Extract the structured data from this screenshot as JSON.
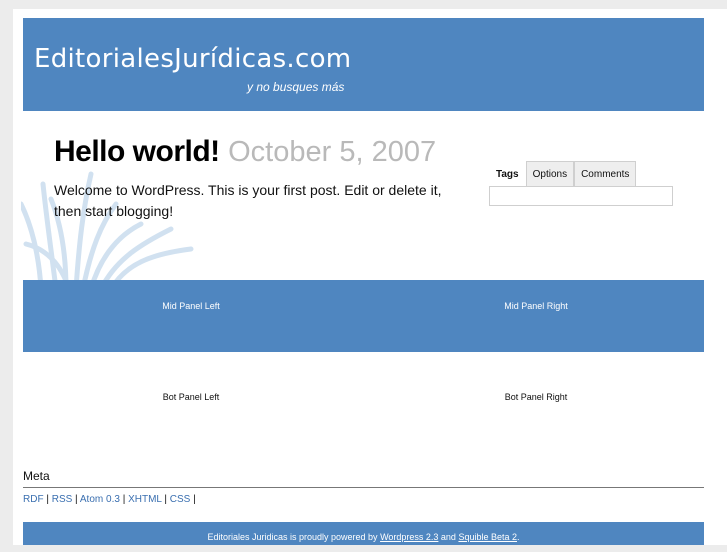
{
  "header": {
    "site_title": "EditorialesJurídicas.com",
    "tagline": "y no busques más",
    "background_color": "#4f86c0"
  },
  "post": {
    "title": "Hello world!",
    "date": "October 5, 2007",
    "body": "Welcome to WordPress. This is your first post. Edit or delete it, then start blogging!"
  },
  "sidebar": {
    "tabs": [
      {
        "label": "Tags",
        "active": true
      },
      {
        "label": "Options",
        "active": false
      },
      {
        "label": "Comments",
        "active": false
      }
    ]
  },
  "panels": {
    "mid_left": "Mid Panel Left",
    "mid_right": "Mid Panel Right",
    "bot_left": "Bot Panel Left",
    "bot_right": "Bot Panel Right"
  },
  "meta": {
    "title": "Meta",
    "links": [
      "RDF",
      "RSS",
      "Atom 0.3",
      "XHTML",
      "CSS"
    ],
    "separator": " | ",
    "link_color": "#3a6fb0"
  },
  "footer": {
    "prefix": "Editoriales Juridicas is proudly powered by ",
    "wordpress_link": "Wordpress 2.3",
    "and": " and ",
    "squible_link": "Squible Beta 2",
    "suffix": "."
  }
}
